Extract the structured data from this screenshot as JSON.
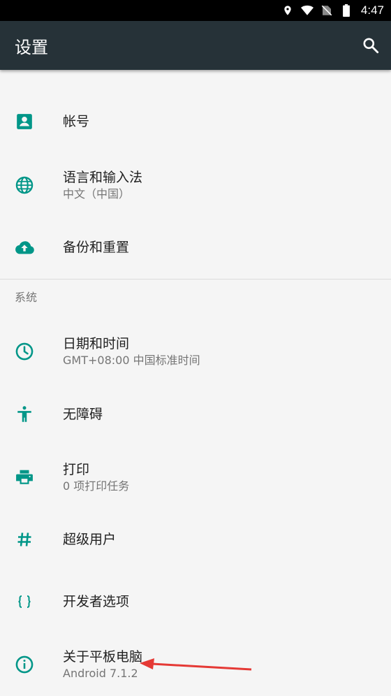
{
  "status_bar": {
    "time": "4:47"
  },
  "toolbar": {
    "title": "设置"
  },
  "personal": [
    {
      "label": "帐号",
      "summary": ""
    },
    {
      "label": "语言和输入法",
      "summary": "中文（中国）"
    },
    {
      "label": "备份和重置",
      "summary": ""
    }
  ],
  "system_header": "系统",
  "system": [
    {
      "label": "日期和时间",
      "summary": "GMT+08:00 中国标准时间"
    },
    {
      "label": "无障碍",
      "summary": ""
    },
    {
      "label": "打印",
      "summary": "0 项打印任务"
    },
    {
      "label": "超级用户",
      "summary": ""
    },
    {
      "label": "开发者选项",
      "summary": ""
    },
    {
      "label": "关于平板电脑",
      "summary": "Android 7.1.2"
    }
  ],
  "colors": {
    "accent": "#009688",
    "toolbar": "#263238",
    "annotation_arrow": "#e53935"
  }
}
